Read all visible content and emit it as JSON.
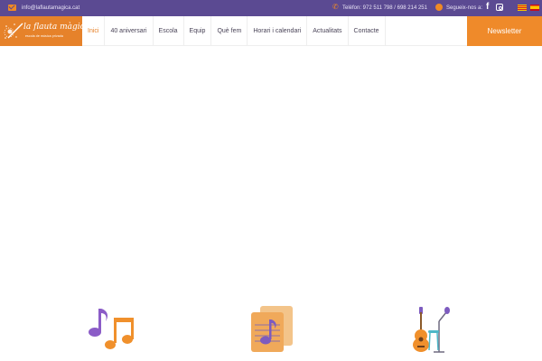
{
  "topbar": {
    "email": "info@laflautamagica.cat",
    "phone": "Telèfon: 972 511 798 / 698 214 251",
    "follow": "Segueix-nos a:",
    "icons": [
      "mail-icon",
      "phone-icon",
      "globe-icon",
      "facebook-icon",
      "instagram-icon"
    ],
    "languages": [
      "ca",
      "es"
    ],
    "background": "#5b4a92"
  },
  "logo": {
    "brand": "la flauta màgica",
    "tagline": "escola de música privada",
    "background": "#e6822a"
  },
  "nav": {
    "items": [
      {
        "label": "Inici",
        "active": true
      },
      {
        "label": "40 aniversari"
      },
      {
        "label": "Escola"
      },
      {
        "label": "Equip"
      },
      {
        "label": "Què fem"
      },
      {
        "label": "Horari i calendari"
      },
      {
        "label": "Actualitats"
      },
      {
        "label": "Contacte"
      }
    ],
    "newsletter": "Newsletter",
    "accent": "#ef8a2a"
  },
  "features": {
    "icons": [
      "music-notes-icon",
      "sheet-music-icon",
      "guitar-microphone-icon"
    ]
  }
}
